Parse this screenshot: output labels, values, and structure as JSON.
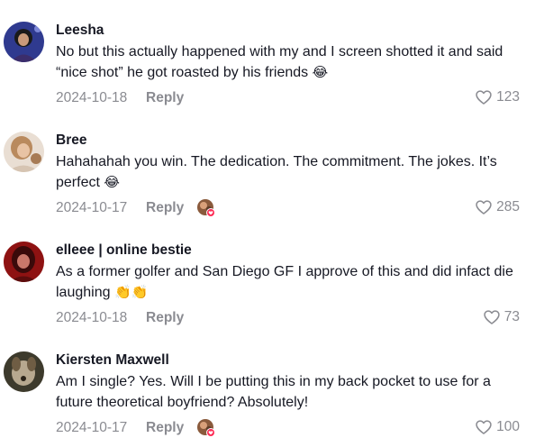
{
  "comments": [
    {
      "author": "Leesha",
      "text": "No but this actually happened with my and I screen shotted it and said “nice shot” he got roasted by his friends",
      "emoji": "😂",
      "date": "2024-10-18",
      "reply_label": "Reply",
      "likes": "123",
      "creator_liked": false
    },
    {
      "author": "Bree",
      "text": "Hahahahah you win. The dedication. The commitment. The jokes. It’s perfect",
      "emoji": "😂",
      "date": "2024-10-17",
      "reply_label": "Reply",
      "likes": "285",
      "creator_liked": true
    },
    {
      "author": "elleee | online bestie",
      "text": "As a former golfer and San Diego GF I approve of this and did infact die laughing",
      "emoji": "👏👏",
      "date": "2024-10-18",
      "reply_label": "Reply",
      "likes": "73",
      "creator_liked": false
    },
    {
      "author": "Kiersten Maxwell",
      "text": "Am I single? Yes. Will I be putting this in my back pocket to use for a future theoretical boyfriend? Absolutely!",
      "emoji": "",
      "date": "2024-10-17",
      "reply_label": "Reply",
      "likes": "100",
      "creator_liked": true
    }
  ],
  "icons": {
    "like": "heart-outline-icon",
    "creator_badge": "creator-liked-avatar-icon"
  },
  "colors": {
    "text": "#161823",
    "meta": "#8a8b91",
    "badge": "#fe2c55"
  }
}
